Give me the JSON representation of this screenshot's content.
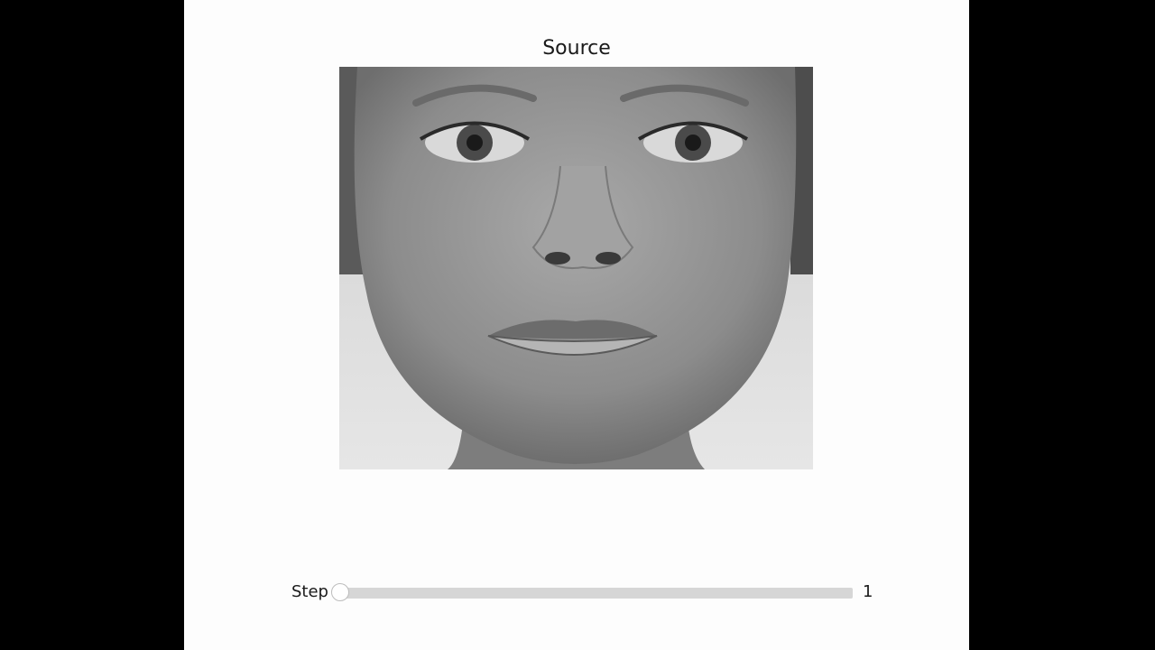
{
  "figure": {
    "title": "Source",
    "image_description_icon": "grayscale-face-photo"
  },
  "slider": {
    "label": "Step",
    "value": "1",
    "min": 1,
    "max": 100,
    "current": 1
  },
  "colors": {
    "background": "#000000",
    "figure_bg": "#fdfdfd",
    "track": "#d6d6d6",
    "handle": "#ffffff"
  }
}
